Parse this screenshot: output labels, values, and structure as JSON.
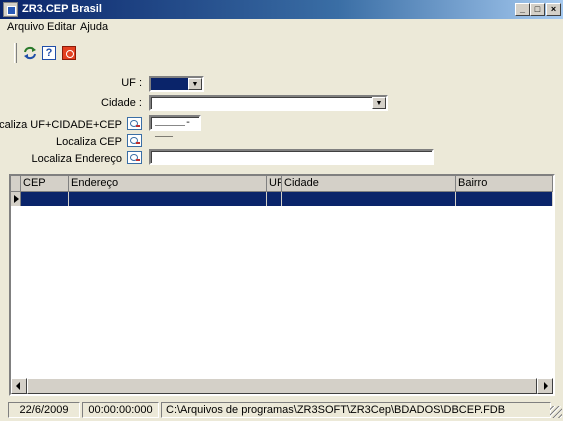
{
  "window": {
    "title": "ZR3.CEP Brasil",
    "minimize": "_",
    "maximize": "□",
    "close": "×"
  },
  "menu": {
    "items": [
      "Arquivo",
      "Editar",
      "Ajuda"
    ]
  },
  "toolbar": {
    "icons": [
      "refresh-icon",
      "help-icon",
      "power-icon"
    ],
    "help_glyph": "?"
  },
  "form": {
    "uf_label": "UF :",
    "uf_value": "",
    "cidade_label": "Cidade :",
    "cidade_value": "",
    "localiza_ufcep_label": "Localiza UF+CIDADE+CEP",
    "cep_mask": "_____-___",
    "localiza_cep_label": "Localiza CEP",
    "localiza_endereco_label": "Localiza Endereço",
    "endereco_value": ""
  },
  "grid": {
    "columns": [
      "CEP",
      "Endereço",
      "UF",
      "Cidade",
      "Bairro"
    ],
    "rows": [
      [
        "",
        "",
        "",
        "",
        ""
      ]
    ]
  },
  "status": {
    "date": "22/6/2009",
    "time": "00:00:00:000",
    "path": "C:\\Arquivos de programas\\ZR3SOFT\\ZR3Cep\\BDADOS\\DBCEP.FDB"
  },
  "colors": {
    "title_start": "#0a246a",
    "title_end": "#a6caf0",
    "selection": "#0a246a",
    "face": "#ece9d8"
  }
}
